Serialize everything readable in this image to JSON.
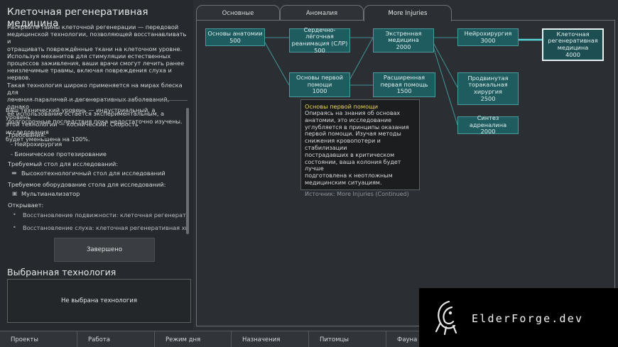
{
  "research": {
    "title": "Клеточная регенеративная медицина",
    "description": "Раскройте тайны клеточной регенерации — передовой\nмедицинской технологии, позволяющей восстанавливать и\nотращивать повреждённые ткани на клеточном уровне.\nИспользуя механитов для стимуляции естественных\nпроцессов заживления, ваши врачи смогут лечить ранее\nнеизлечимые травмы, включая повреждения слуха и нервов.\nТакая технология широко применяется на мирах блеска для\nлечения параличей и дегенеративных заболеваний, однако\neё использование остаётся экспериментальным, а\nдолгосрочные последствия пока недостаточно изучены.",
    "tech_level": "Ваш технический уровень — индустриальный, а уровень\nэтой технологии — космический. Скорость исследования\nбудет уменьшена на 100%.",
    "requirements_label": "Требования:",
    "requirements": [
      "- Нейрохирургия",
      "- Бионическое протезирование"
    ],
    "bench_label": "Требуемый стол для исследований:",
    "bench_value": "Высокотехнологичный стол для исследований",
    "equipment_label": "Требуемое оборудование стола для исследований:",
    "equipment_value": "Мультианализатор",
    "unlocks_label": "Открывает:",
    "unlocks": [
      "Восстановление подвижности: клеточная регенеративн",
      "Восстановление слуха: клеточная регенеративная хиру"
    ],
    "done_button": "Завершено"
  },
  "selected_tech": {
    "title": "Выбранная технология",
    "placeholder": "Не выбрана технология"
  },
  "tabs": [
    "Основные",
    "Аномалия",
    "More Injuries"
  ],
  "active_tab": "More Injuries",
  "nodes": {
    "anatomy": {
      "name": "Основы анатомии",
      "cost": "500"
    },
    "cpr": {
      "name": "Сердечно-лёгочная реанимация (СЛР)",
      "cost": "500"
    },
    "emergency": {
      "name": "Экстренная медицина",
      "cost": "2000"
    },
    "neurosurgery": {
      "name": "Нейрохирургия",
      "cost": "3000"
    },
    "cellular": {
      "name": "Клеточная регенеративная медицина",
      "cost": "4000"
    },
    "first_aid": {
      "name": "Основы первой помощи",
      "cost": "1000"
    },
    "adv_first_aid": {
      "name": "Расширенная первая помощь",
      "cost": "1500"
    },
    "thoracic": {
      "name": "Продвинутая торакальная хирургия",
      "cost": "2500"
    },
    "adrenaline": {
      "name": "Синтез адреналина",
      "cost": "2000"
    }
  },
  "tooltip": {
    "title": "Основы первой помощи",
    "body": "Опираясь на знания об основах\nанатомии, это исследование\nуглубляется в принципы оказания\nпервой помощи. Изучая методы\nснижения кровопотери и стабилизации\nпострадавших в критическом\nсостоянии, ваша колония будет лучше\nподготовлена к неотложным\nмедицинским ситуациям.",
    "source": "Источник: More Injuries (Continued)"
  },
  "bottom_tabs": [
    "Проекты",
    "Работа",
    "Режим дня",
    "Назначения",
    "Питомцы",
    "Фауна"
  ],
  "watermark": {
    "text": "ElderForge.dev"
  },
  "colors": {
    "node_fill": "#1f5c5f",
    "node_border": "#4a9a9c",
    "tooltip_title": "#e8d35b",
    "selected_border": "#e6f3f3"
  }
}
